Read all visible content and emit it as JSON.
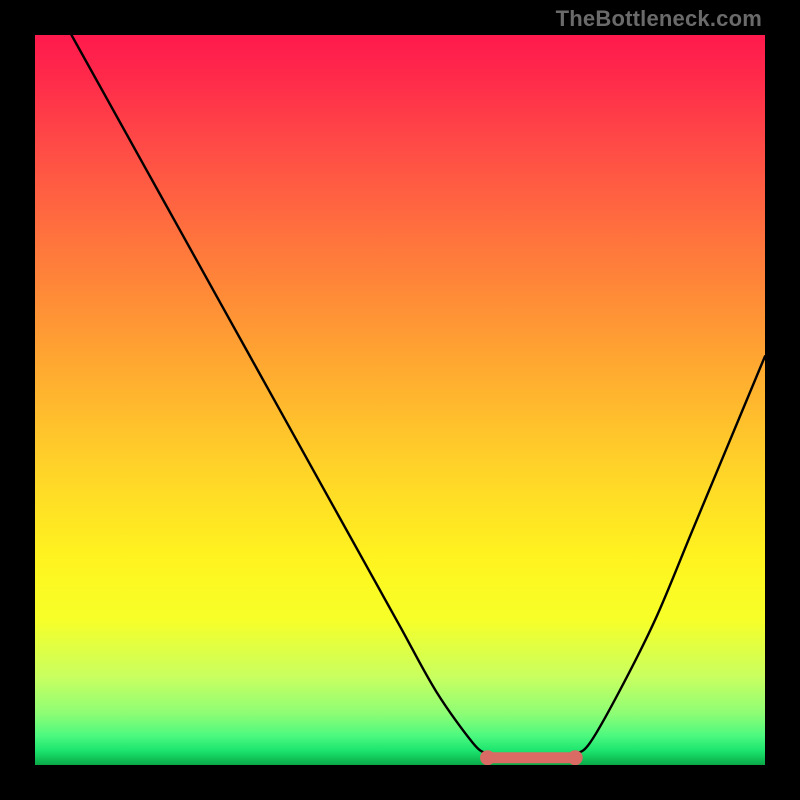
{
  "attribution": "TheBottleneck.com",
  "chart_data": {
    "type": "line",
    "title": "",
    "xlabel": "",
    "ylabel": "",
    "xlim": [
      0,
      100
    ],
    "ylim": [
      0,
      100
    ],
    "grid": false,
    "series": [
      {
        "name": "curve",
        "x": [
          5,
          10,
          15,
          20,
          25,
          30,
          35,
          40,
          45,
          50,
          55,
          60,
          62,
          64,
          68,
          72,
          74,
          76,
          80,
          85,
          90,
          95,
          100
        ],
        "y": [
          100,
          91,
          82,
          73,
          64,
          55,
          46,
          37,
          28,
          19,
          10,
          3,
          1.5,
          0.8,
          0.6,
          0.8,
          1.5,
          3,
          10,
          20,
          32,
          44,
          56
        ]
      }
    ],
    "flat_segment": {
      "x_start": 62,
      "x_end": 74,
      "y": 1,
      "color": "#d96a64",
      "endcap_radius": 1.1
    },
    "background_gradient": {
      "stops": [
        {
          "pos": 0.0,
          "color": "#ff1a4d"
        },
        {
          "pos": 0.14,
          "color": "#ff4747"
        },
        {
          "pos": 0.36,
          "color": "#ff8c37"
        },
        {
          "pos": 0.6,
          "color": "#ffd528"
        },
        {
          "pos": 0.8,
          "color": "#f7ff28"
        },
        {
          "pos": 0.93,
          "color": "#8dfd75"
        },
        {
          "pos": 1.0,
          "color": "#0aa847"
        }
      ]
    }
  }
}
